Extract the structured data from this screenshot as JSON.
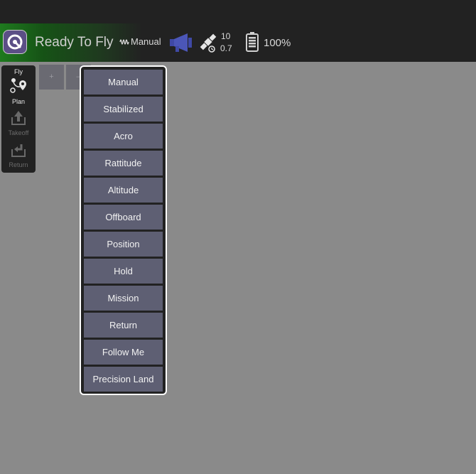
{
  "toolbar": {
    "vehicle_status": "Ready To Fly",
    "flight_mode": "Manual",
    "gps_satellite_count": "10",
    "gps_hdop": "0.7",
    "battery_percent": "100%",
    "status_color": "#1e7a1e"
  },
  "plan_tools": {
    "fly_label": "Fly",
    "plan_label": "Plan",
    "takeoff_label": "Takeoff",
    "return_label": "Return"
  },
  "map_controls": {
    "zoom_in_label": "+",
    "zoom_out_label": "–"
  },
  "flight_mode_menu": {
    "items": [
      "Manual",
      "Stabilized",
      "Acro",
      "Rattitude",
      "Altitude",
      "Offboard",
      "Position",
      "Hold",
      "Mission",
      "Return",
      "Follow Me",
      "Precision Land"
    ]
  },
  "colors": {
    "menu_button": "#5e5f73",
    "map_background": "#8a8a8a",
    "toolbar_dark": "#222222"
  }
}
